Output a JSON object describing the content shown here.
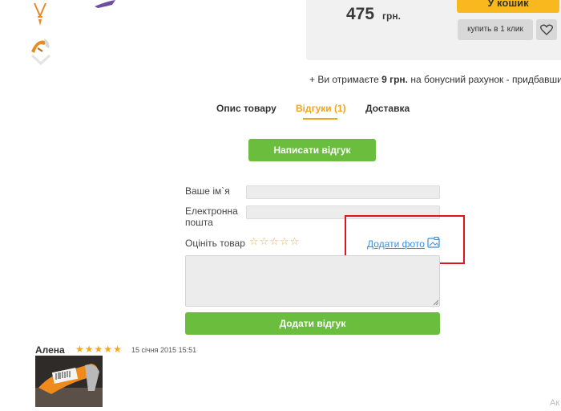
{
  "product": {
    "price": "475",
    "currency": "грн.",
    "cart_button": "У кошик",
    "one_click_button": "купить в 1 клик",
    "bonus": {
      "prefix": "+ Ви отримаєте",
      "amount": "9 грн.",
      "suffix": "на бонусний рахунок - придбавши це"
    }
  },
  "tabs": [
    {
      "label": "Опис товару"
    },
    {
      "label": "Відгуки (1)",
      "active": true
    },
    {
      "label": "Доставка"
    }
  ],
  "review_form": {
    "write_button": "Написати відгук",
    "name_label": "Ваше ім`я",
    "email_label": "Електронна пошта",
    "rating_label": "Оцініть товар",
    "add_photo_link": "Додати фото",
    "submit_button": "Додати відгук",
    "star_count": 5
  },
  "reviews": [
    {
      "author": "Алена",
      "rating": 5,
      "date": "15 січня 2015 15:51"
    }
  ],
  "corner_text": "Ак",
  "colors": {
    "green_button": "#6bbd3e",
    "orange_accent": "#f0a422",
    "cart_yellow": "#f9b91e",
    "highlight_red": "#e0141b",
    "link_blue": "#3d8ed8"
  }
}
